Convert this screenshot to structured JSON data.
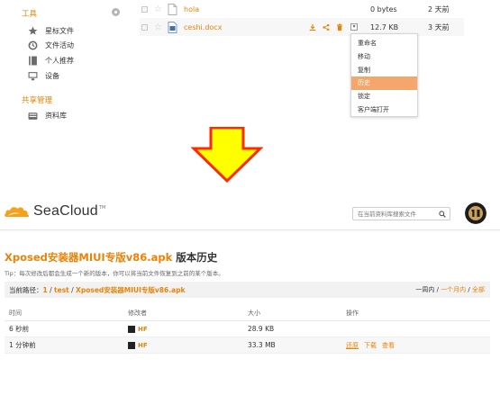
{
  "sidebar": {
    "tools_heading": "工具",
    "items": [
      {
        "label": "星标文件",
        "icon": "star-icon"
      },
      {
        "label": "文件活动",
        "icon": "history-icon"
      },
      {
        "label": "个人推荐",
        "icon": "bookmark-icon"
      },
      {
        "label": "设备",
        "icon": "monitor-icon"
      }
    ],
    "share_heading": "共享管理",
    "share_items": [
      {
        "label": "资料库",
        "icon": "library-icon"
      }
    ]
  },
  "files": [
    {
      "name": "hola",
      "size": "0 bytes",
      "time": "2 天前"
    },
    {
      "name": "ceshi.docx",
      "size": "12.7 KB",
      "time": "3 天前"
    }
  ],
  "context_menu": {
    "items": [
      "重命名",
      "移动",
      "复制",
      "历史",
      "锁定",
      "客户端打开"
    ],
    "active_index": 3
  },
  "arrow": {
    "color": "#ffff00",
    "stroke": "#ff2a00"
  },
  "header": {
    "logo_prefix": "Sea",
    "logo_suffix": "Cloud",
    "logo_tm": "TM",
    "search_placeholder": "在当前资料库搜索文件"
  },
  "history": {
    "file_title": "Xposed安装器MIUI专版v86.apk",
    "title_suffix": " 版本历史",
    "tip": "Tip：每次修改后都会生成一个新的版本，你可以将当前文件恢复到之前的某个版本。",
    "path_label": "当前路径：",
    "path_links": [
      "1",
      "test",
      "Xposed安装器MIUI专版v86.apk"
    ],
    "path_sep": " / ",
    "filters": [
      "一周内",
      "一个月内",
      "全部"
    ],
    "filter_sep": " / ",
    "columns": [
      "时间",
      "修改者",
      "大小",
      "操作"
    ],
    "rows": [
      {
        "time": "6 秒前",
        "modifier": "HF",
        "size": "28.9 KB",
        "ops": []
      },
      {
        "time": "1 分钟前",
        "modifier": "HF",
        "size": "33.3 MB",
        "ops": [
          "还原",
          "下载",
          "查看"
        ]
      }
    ]
  },
  "colors": {
    "accent": "#eb8205",
    "menu_active": "#f5a66a"
  }
}
